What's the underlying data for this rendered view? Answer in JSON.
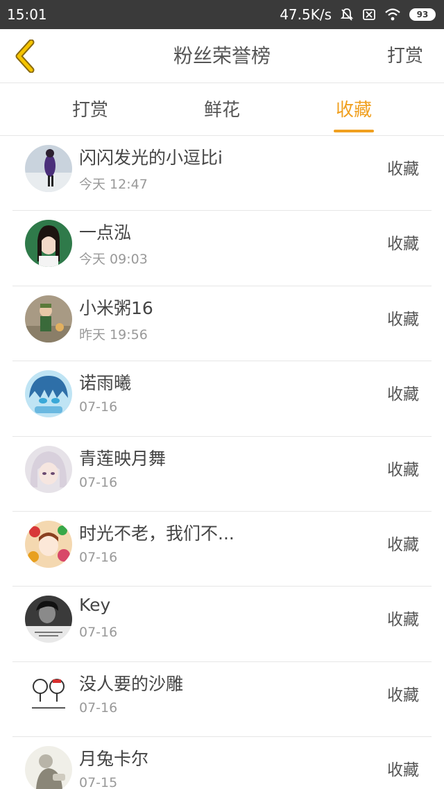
{
  "status_bar": {
    "time": "15:01",
    "net_speed": "47.5K/s",
    "battery": "93",
    "icons": [
      "bell-muted-icon",
      "sim-off-icon",
      "wifi-icon",
      "battery-icon"
    ]
  },
  "header": {
    "title": "粉丝荣誉榜",
    "action_label": "打赏",
    "back_icon": "chevron-left-icon",
    "accent": "#f0a020"
  },
  "tabs": [
    {
      "label": "打赏",
      "active": false
    },
    {
      "label": "鲜花",
      "active": false
    },
    {
      "label": "收藏",
      "active": true
    }
  ],
  "fans": [
    {
      "name": "闪闪发光的小逗比i",
      "time": "今天 12:47",
      "action": "收藏",
      "avatar": "avatar-icon"
    },
    {
      "name": "一点泓",
      "time": "今天 09:03",
      "action": "收藏",
      "avatar": "avatar-icon"
    },
    {
      "name": "小米粥16",
      "time": "昨天 19:56",
      "action": "收藏",
      "avatar": "avatar-icon"
    },
    {
      "name": "诺雨曦",
      "time": "07-16",
      "action": "收藏",
      "avatar": "avatar-icon"
    },
    {
      "name": "青莲映月舞",
      "time": "07-16",
      "action": "收藏",
      "avatar": "avatar-icon"
    },
    {
      "name": "时光不老，我们不...",
      "time": "07-16",
      "action": "收藏",
      "avatar": "avatar-icon"
    },
    {
      "name": "Key",
      "time": "07-16",
      "action": "收藏",
      "avatar": "avatar-icon"
    },
    {
      "name": "没人要的沙雕",
      "time": "07-16",
      "action": "收藏",
      "avatar": "avatar-icon"
    },
    {
      "name": "月兔卡尔",
      "time": "07-15",
      "action": "收藏",
      "avatar": "avatar-icon"
    }
  ]
}
